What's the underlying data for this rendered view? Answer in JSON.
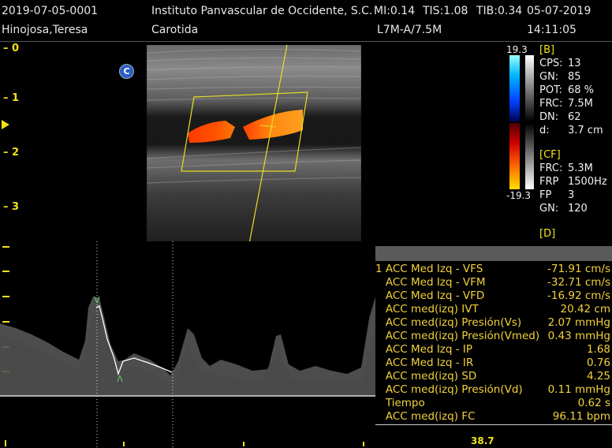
{
  "header": {
    "patient_id": "2019-07-05-0001",
    "institution": "Instituto Panvascular de Occidente, S.C.",
    "mi": "MI:0.14",
    "tis": "TIS:1.08",
    "tib": "TIB:0.34",
    "date": "05-07-2019",
    "patient_name": "Hinojosa,Teresa",
    "exam": "Carotida",
    "probe": "L7M-A/7.5M",
    "time": "14:11:05"
  },
  "depth_scale": {
    "labels": [
      "0",
      "1",
      "2",
      "3"
    ]
  },
  "mode_badge": "C",
  "color_scale": {
    "max": "19.3",
    "min": "-19.3"
  },
  "b_mode": {
    "title": "[B]",
    "params": [
      {
        "label": "CPS:",
        "value": "13"
      },
      {
        "label": "GN:",
        "value": "85"
      },
      {
        "label": "POT:",
        "value": "68 %"
      },
      {
        "label": "FRC:",
        "value": "7.5M"
      },
      {
        "label": "DN:",
        "value": "62"
      },
      {
        "label": "d:",
        "value": "3.7 cm"
      }
    ]
  },
  "cf_mode": {
    "title": "[CF]",
    "params": [
      {
        "label": "FRC:",
        "value": "5.3M"
      },
      {
        "label": "FRP",
        "value": "1500Hz"
      },
      {
        "label": "FP",
        "value": "3"
      },
      {
        "label": "GN:",
        "value": "120"
      }
    ]
  },
  "d_mode": {
    "title": "[D]"
  },
  "measurements": [
    {
      "label": "1 ACC  Med Izq - VFS",
      "value": "-71.91 cm/s"
    },
    {
      "label": "   ACC Med Izq - VFM",
      "value": "-32.71 cm/s"
    },
    {
      "label": "   ACC Med Izq - VFD",
      "value": "-16.92 cm/s"
    },
    {
      "label": "   ACC med(izq) IVT",
      "value": "20.42 cm"
    },
    {
      "label": "   ACC med(izq) Presión(Vs)",
      "value": "2.07 mmHg"
    },
    {
      "label": "   ACC med(izq) Presión(Vmed)",
      "value": "0.43 mmHg"
    },
    {
      "label": "   ACC Med Izq - IP",
      "value": "1.68"
    },
    {
      "label": "   ACC Med Izq - IR",
      "value": "0.76"
    },
    {
      "label": "   ACC med(izq) SD",
      "value": "4.25"
    },
    {
      "label": "   ACC med(izq) Presión(Vd)",
      "value": "0.11 mmHg"
    },
    {
      "label": "   Tiempo",
      "value": "0.62 s"
    },
    {
      "label": "   ACC med(izq) FC",
      "value": "96.11 bpm"
    }
  ],
  "footer_value": "38.7",
  "colors": {
    "accent_yellow": "#f2e21a",
    "measure_text": "#f2d23a",
    "flow_red": "#ff3a00",
    "flow_orange": "#ff9a10"
  }
}
